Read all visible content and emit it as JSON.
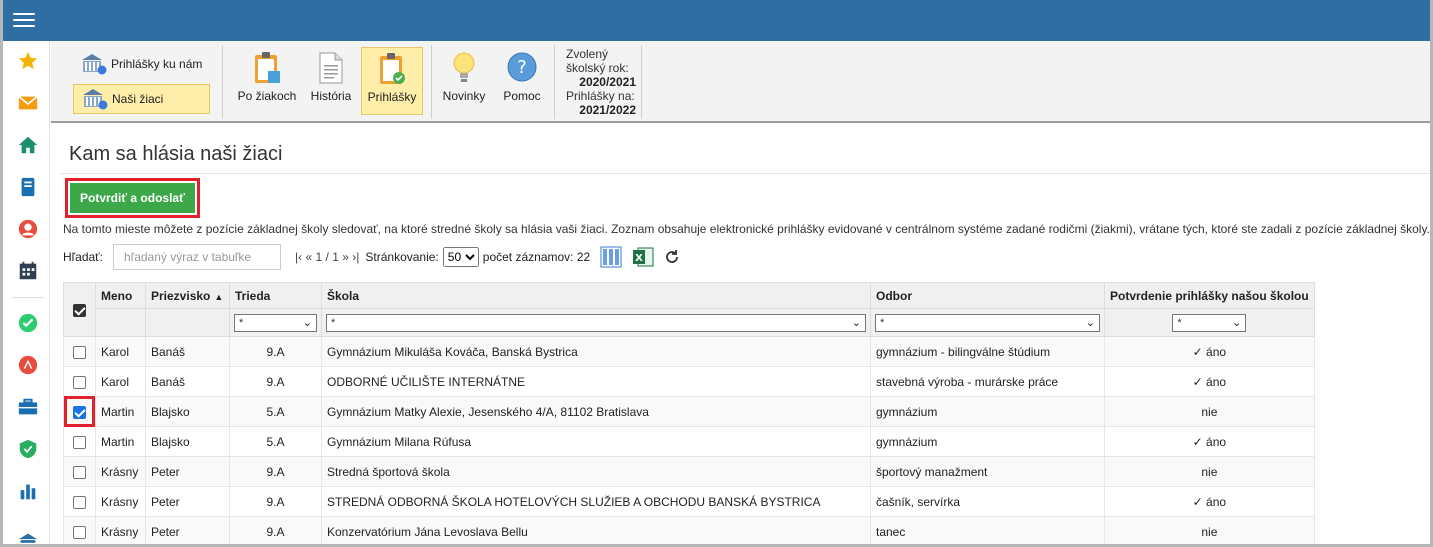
{
  "toolbar": {
    "prihlasky_ku_nam": "Prihlášky ku nám",
    "nasi_ziaci": "Naši žiaci",
    "po_ziakoch": "Po žiakoch",
    "historia": "História",
    "prihlasky": "Prihlášky",
    "novinky": "Novinky",
    "pomoc": "Pomoc",
    "zvoleny_label": "Zvolený školský rok:",
    "zvoleny_value": "2020/2021",
    "prihlasky_na_label": "Prihlášky na:",
    "prihlasky_na_value": "2021/2022"
  },
  "page": {
    "title": "Kam sa hlásia naši žiaci",
    "confirm_button": "Potvrdiť a odoslať",
    "info": "Na tomto mieste môžete z pozície základnej školy sledovať, na ktoré stredné školy sa hlásia vaši žiaci. Zoznam obsahuje elektronické prihlášky evidované v centrálnom systéme zadané rodičmi (žiakmi), vrátane tých, ktoré ste zadali z pozície základnej školy."
  },
  "search": {
    "label": "Hľadať:",
    "placeholder": "hľadaný výraz v tabuľke"
  },
  "pager": {
    "first": "|‹",
    "prev": "«",
    "pages": "1 / 1",
    "next": "»",
    "last": "›|",
    "page_size_label": "Stránkovanie:",
    "page_size": "50",
    "count_label": "počet záznamov: 22"
  },
  "table": {
    "headers": {
      "meno": "Meno",
      "priezvisko": "Priezvisko",
      "trieda": "Trieda",
      "skola": "Škola",
      "odbor": "Odbor",
      "potvrdenie": "Potvrdenie prihlášky našou školou"
    },
    "filter_value": "*",
    "rows": [
      {
        "meno": "Karol",
        "priezvisko": "Banáš",
        "trieda": "9.A",
        "skola": "Gymnázium Mikuláša Kováča, Banská Bystrica",
        "odbor": "gymnázium - bilingválne štúdium",
        "potvrdenie": "✓ áno",
        "checked": false
      },
      {
        "meno": "Karol",
        "priezvisko": "Banáš",
        "trieda": "9.A",
        "skola": "ODBORNÉ UČILIŠTE INTERNÁTNE",
        "odbor": "stavebná výroba - murárske práce",
        "potvrdenie": "✓ áno",
        "checked": false
      },
      {
        "meno": "Martin",
        "priezvisko": "Blajsko",
        "trieda": "5.A",
        "skola": "Gymnázium Matky Alexie, Jesenského 4/A, 81102 Bratislava",
        "odbor": "gymnázium",
        "potvrdenie": "nie",
        "checked": true
      },
      {
        "meno": "Martin",
        "priezvisko": "Blajsko",
        "trieda": "5.A",
        "skola": "Gymnázium Milana Rúfusa",
        "odbor": "gymnázium",
        "potvrdenie": "✓ áno",
        "checked": false
      },
      {
        "meno": "Krásny",
        "priezvisko": "Peter",
        "trieda": "9.A",
        "skola": "Stredná športová škola",
        "odbor": "športový manažment",
        "potvrdenie": "nie",
        "checked": false
      },
      {
        "meno": "Krásny",
        "priezvisko": "Peter",
        "trieda": "9.A",
        "skola": "STREDNÁ ODBORNÁ ŠKOLA HOTELOVÝCH SLUŽIEB A OBCHODU BANSKÁ BYSTRICA",
        "odbor": "čašník, servírka",
        "potvrdenie": "✓ áno",
        "checked": false
      },
      {
        "meno": "Krásny",
        "priezvisko": "Peter",
        "trieda": "9.A",
        "skola": "Konzervatórium Jána Levoslava Bellu",
        "odbor": "tanec",
        "potvrdenie": "nie",
        "checked": false
      }
    ]
  }
}
